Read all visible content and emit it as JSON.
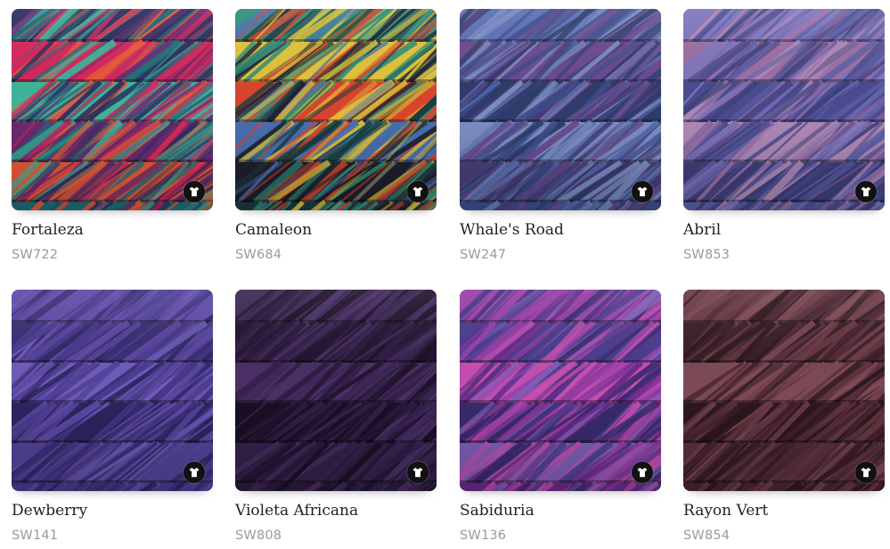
{
  "products": [
    {
      "name": "Fortaleza",
      "code": "SW722",
      "palette": [
        "#1d6f7a",
        "#2b2d5e",
        "#d6265b",
        "#3fb39a",
        "#6a2b72",
        "#e85a3a"
      ],
      "button_icon": "tshirt-icon"
    },
    {
      "name": "Camaleon",
      "code": "SW684",
      "palette": [
        "#1a3b3f",
        "#2f8f7a",
        "#e0c23a",
        "#d8452e",
        "#4a6fb0",
        "#1f1f2e"
      ],
      "button_icon": "tshirt-icon"
    },
    {
      "name": "Whale's Road",
      "code": "SW247",
      "palette": [
        "#3d4f8f",
        "#5b6fb3",
        "#6b4a8e",
        "#2f3c6b",
        "#7d8fc4",
        "#4a3f7a"
      ],
      "button_icon": "tshirt-icon"
    },
    {
      "name": "Abril",
      "code": "SW853",
      "palette": [
        "#5c5fa8",
        "#7d76c0",
        "#9b6fa5",
        "#4a4b8e",
        "#b08ab8",
        "#3f3f7a"
      ],
      "button_icon": "tshirt-icon"
    },
    {
      "name": "Dewberry",
      "code": "SW141",
      "palette": [
        "#4a3a8e",
        "#5f4ba8",
        "#3a2d73",
        "#6e5cb8",
        "#2e2460",
        "#54439a"
      ],
      "button_icon": "tshirt-icon"
    },
    {
      "name": "Violeta Africana",
      "code": "SW808",
      "palette": [
        "#2b1a3e",
        "#3d2756",
        "#22142f",
        "#4a3066",
        "#1a0f25",
        "#35214b"
      ],
      "button_icon": "tshirt-icon"
    },
    {
      "name": "Sabiduria",
      "code": "SW136",
      "palette": [
        "#6a2a8a",
        "#9a3fa8",
        "#4a3d8e",
        "#c44fb0",
        "#3a2a6e",
        "#7e5fb8"
      ],
      "button_icon": "tshirt-icon"
    },
    {
      "name": "Rayon Vert",
      "code": "SW854",
      "palette": [
        "#4a2530",
        "#6b3a45",
        "#3a1e28",
        "#7d4a55",
        "#2e171f",
        "#5a3040"
      ],
      "button_icon": "tshirt-icon"
    }
  ]
}
